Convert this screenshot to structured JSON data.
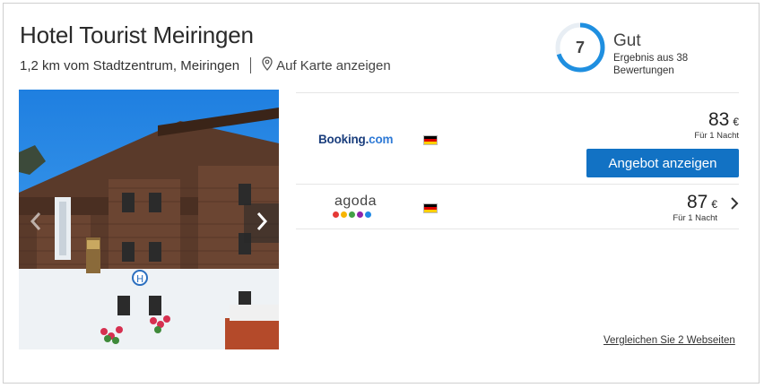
{
  "hotel": {
    "name": "Hotel Tourist Meiringen",
    "distance": "1,2 km vom Stadtzentrum, Meiringen",
    "map_link": "Auf Karte anzeigen"
  },
  "rating": {
    "score": "7",
    "score_fraction": 0.7,
    "label": "Gut",
    "count_text": "Ergebnis aus 38 Bewertungen",
    "color": "#1f8fe0"
  },
  "offers": [
    {
      "provider": "Booking.com",
      "provider_parts": [
        "Booking",
        ".",
        "com"
      ],
      "flag": "germany-flag",
      "price": "83",
      "currency": "€",
      "price_note": "Für 1 Nacht",
      "cta": "Angebot anzeigen"
    },
    {
      "provider": "agoda",
      "flag": "germany-flag",
      "price": "87",
      "currency": "€",
      "price_note": "Für 1 Nacht",
      "dot_colors": [
        "#e53935",
        "#f7b500",
        "#43a047",
        "#8e24aa",
        "#1e88e5"
      ]
    }
  ],
  "compare_link": "Vergleichen Sie 2 Webseiten",
  "gallery": {
    "prev_icon": "chevron-left-icon",
    "next_icon": "chevron-right-icon"
  },
  "colors": {
    "cta": "#1272c4",
    "booking_brand": "#1a3e7d"
  }
}
